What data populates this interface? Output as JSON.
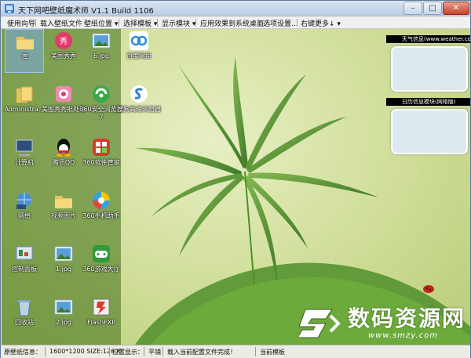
{
  "window": {
    "title": "天下网吧壁纸魔术师 V1.1 Build 1106",
    "min": "–",
    "max": "□",
    "close": "✕"
  },
  "menu": [
    "使用向导",
    "载入壁纸文件",
    "壁纸位置 ▾",
    "选择模板 ▾",
    "显示模块 ▾",
    "应用效果到系统桌面",
    "选项设置...",
    "右键更多↓ ▾"
  ],
  "desktop_icons": [
    {
      "label": "库",
      "icon": "folder-icon"
    },
    {
      "label": "美图秀秀",
      "icon": "meitu-icon"
    },
    {
      "label": "6.jpg",
      "icon": "image-file-icon"
    },
    {
      "label": "百度网盘",
      "icon": "baidu-cloud-icon"
    },
    {
      "label": "Administra...",
      "icon": "user-folder-icon"
    },
    {
      "label": "美图秀秀批处理",
      "icon": "meitu-batch-icon"
    },
    {
      "label": "360安全浏览器7",
      "icon": "360-browser-icon"
    },
    {
      "label": "搜狗高速浏览器",
      "icon": "sogou-browser-icon"
    },
    {
      "label": "计算机",
      "icon": "computer-icon"
    },
    {
      "label": "腾讯QQ",
      "icon": "qq-icon"
    },
    {
      "label": "360软件管家",
      "icon": "360-software-icon"
    },
    {
      "label": "网络",
      "icon": "network-icon"
    },
    {
      "label": "视频图片",
      "icon": "folder-icon"
    },
    {
      "label": "360手机助手",
      "icon": "360-phone-icon"
    },
    {
      "label": "控制面板",
      "icon": "control-panel-icon"
    },
    {
      "label": "1.jpg",
      "icon": "image-file-icon"
    },
    {
      "label": "360游戏大厅",
      "icon": "360-game-icon"
    },
    {
      "label": "回收站",
      "icon": "recycle-bin-icon"
    },
    {
      "label": "2.jpg",
      "icon": "image-file-icon"
    },
    {
      "label": "FlashFXP",
      "icon": "flashfxp-icon"
    }
  ],
  "widgets": [
    {
      "title": "天气信息(www.weather.com.cn)"
    },
    {
      "title": "日历信息模块(网络版)"
    }
  ],
  "status": {
    "info_label": "原壁纸信息：",
    "size_info": "1600*1200 SIZE:126 K",
    "position_label": "位置显示：",
    "position_value": "平铺",
    "message": "载入当前配置文件完成！",
    "template": "当前模板"
  },
  "watermark": {
    "title": "数码资源网",
    "url": "www.smzy.com"
  },
  "colors": {
    "accent": "#5d7a9c",
    "desktop": "#d3e09e",
    "leaf": "#4f8f2a"
  }
}
